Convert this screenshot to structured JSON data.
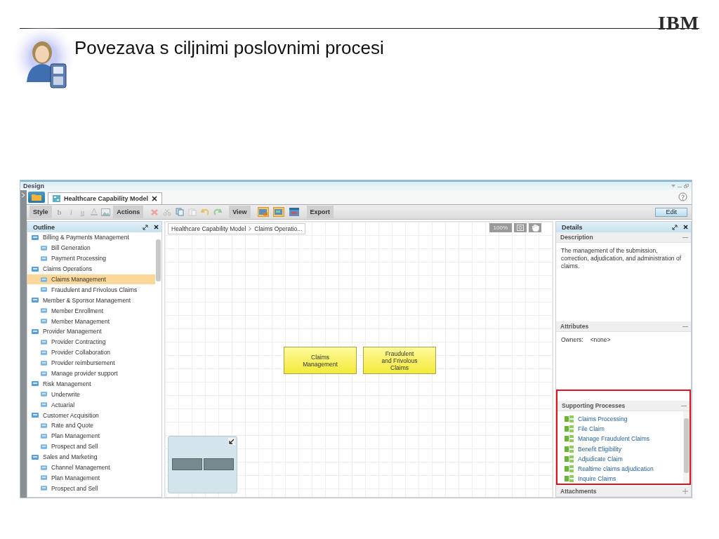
{
  "slide": {
    "logo": "IBM",
    "title": "Povezava s ciljnimi poslovnimi procesi"
  },
  "window": {
    "title": "Design"
  },
  "tabs": [
    {
      "label": "Healthcare Capability Model",
      "selected": true
    }
  ],
  "toolbar": {
    "groups": [
      {
        "label": "Style",
        "kind": "style",
        "buttons": [
          {
            "label": "b",
            "disabled": true
          },
          {
            "label": "i",
            "disabled": true
          },
          {
            "label": "u",
            "disabled": true
          }
        ]
      },
      {
        "label": "Actions",
        "kind": "actions"
      },
      {
        "label": "View",
        "kind": "view"
      },
      {
        "label": "Export",
        "kind": "plain"
      }
    ],
    "edit": "Edit"
  },
  "outline": {
    "title": "Outline",
    "items": [
      {
        "label": "Billing & Payments Management",
        "selected": false,
        "children": [
          {
            "label": "Bill Generation",
            "selected": false
          },
          {
            "label": "Payment Processing",
            "selected": false
          }
        ]
      },
      {
        "label": "Claims Operations",
        "selected": false,
        "children": [
          {
            "label": "Claims Management",
            "selected": true
          },
          {
            "label": "Fraudulent and Frivolous Claims",
            "selected": false
          }
        ]
      },
      {
        "label": "Member & Sponsor Management",
        "selected": false,
        "children": [
          {
            "label": "Member Enrollment",
            "selected": false
          },
          {
            "label": "Member Management",
            "selected": false
          }
        ]
      },
      {
        "label": "Provider Management",
        "selected": false,
        "children": [
          {
            "label": "Provider Contracting",
            "selected": false
          },
          {
            "label": "Provider Collaboration",
            "selected": false
          },
          {
            "label": "Provider reimbursement",
            "selected": false
          },
          {
            "label": "Manage provider support",
            "selected": false
          }
        ]
      },
      {
        "label": "Risk Management",
        "selected": false,
        "children": [
          {
            "label": "Underwrite",
            "selected": false
          },
          {
            "label": "Actuarial",
            "selected": false
          }
        ]
      },
      {
        "label": "Customer Acquisition",
        "selected": false,
        "children": [
          {
            "label": "Rate and Quote",
            "selected": false
          },
          {
            "label": "Plan Management",
            "selected": false
          },
          {
            "label": "Prospect and Sell",
            "selected": false
          }
        ]
      },
      {
        "label": "Sales and Marketing",
        "selected": false,
        "children": [
          {
            "label": "Channel Management",
            "selected": false
          },
          {
            "label": "Plan Management",
            "selected": false
          },
          {
            "label": "Prospect and Sell",
            "selected": false
          }
        ]
      }
    ]
  },
  "canvas": {
    "breadcrumb": [
      "Healthcare Capability Model",
      "Claims Operatio..."
    ],
    "zoom": "100%",
    "nodes": [
      {
        "label": "Claims Management"
      },
      {
        "label": "Fraudulent and Frivolous Claims"
      }
    ]
  },
  "details": {
    "title": "Details",
    "sections": [
      {
        "title": "Description",
        "kind": "text",
        "expanded": true,
        "highlighted": false,
        "text": "The management of the submission, correction, adjudication, and administration of claims."
      },
      {
        "title": "Attributes",
        "kind": "properties",
        "expanded": true,
        "highlighted": false,
        "properties": [
          {
            "key": "Owners:",
            "value": "<none>"
          }
        ]
      },
      {
        "title": "Supporting Processes",
        "kind": "links",
        "expanded": true,
        "highlighted": true,
        "items": [
          "Claims Processing",
          "File Claim",
          "Manage Fraudulent Claims",
          "Benefit Eligibility",
          "Adjudicate Claim",
          "Realtime claims adjudication",
          "Inquire Claims"
        ]
      },
      {
        "title": "Attachments",
        "kind": "text",
        "expanded": false,
        "highlighted": false
      }
    ]
  }
}
